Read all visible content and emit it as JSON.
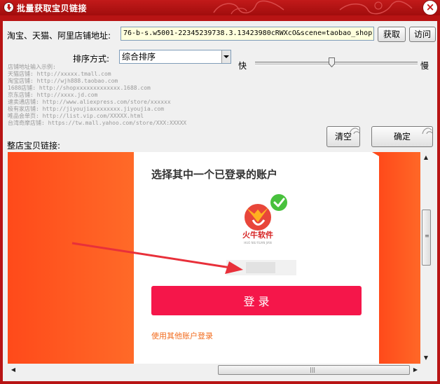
{
  "window": {
    "title": "批量获取宝贝链接",
    "close_label": "×"
  },
  "form": {
    "shop_url_label": "淘宝、天猫、阿里店铺地址:",
    "shop_url_value": "76-b-s.w5001-22345239738.3.13423980cRWXcO&scene=taobao_shop",
    "fetch_label": "获取",
    "visit_label": "访问",
    "sort_label": "排序方式:",
    "sort_value": "综合排序",
    "speed_fast": "快",
    "speed_slow": "慢",
    "speed_level": 0.47,
    "clear_label": "清空",
    "confirm_label": "确定",
    "links_label": "整店宝贝链接:"
  },
  "examples": [
    "店铺地址输入示例:",
    "天猫店铺: http://xxxxx.tmall.com",
    "淘宝店铺: http://wjh888.taobao.com",
    "1688店铺: http://shopxxxxxxxxxxxxx.1688.com",
    "京东店铺: http://xxxx.jd.com",
    "速卖通店铺: http://www.aliexpress.com/store/xxxxxx",
    "极有家店铺: http://jiyoujiaxxxxxxxx.jiyoujia.com",
    "唯品会单页: http://list.vip.com/XXXXX.html",
    "台湾奇摩店铺: https://tw.mall.yahoo.com/store/XXX:XXXXX"
  ],
  "login": {
    "heading": "选择其中一个已登录的账户",
    "logo_text": "火牛软件",
    "logo_subtext": "HUO NIU RUAN JIAN",
    "login_button": "登 录",
    "other_account_link": "使用其他账户登录"
  },
  "colors": {
    "title_red": "#b81414",
    "panel_orange": "#ff5a1e",
    "login_button": "#f5164a",
    "check_green": "#48c13d",
    "arrow_red": "#e8303a",
    "link_orange": "#f26b1d"
  }
}
